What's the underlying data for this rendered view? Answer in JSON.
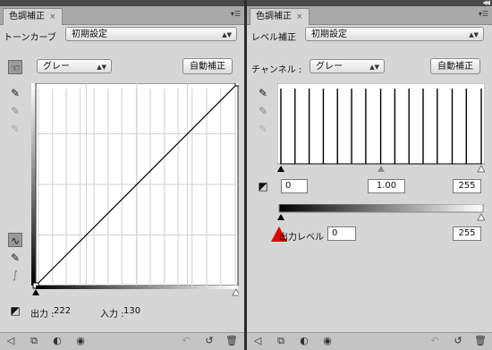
{
  "left": {
    "tab_title": "色調補正",
    "tab_close": "×",
    "preset_label": "トーンカーブ",
    "preset_value": "初期設定",
    "channel_value": "グレー",
    "auto_button": "自動補正",
    "output_label": "出力 :",
    "output_value": "222",
    "input_label": "入力 :",
    "input_value": "130",
    "curve_points": [
      [
        0,
        0
      ],
      [
        255,
        255
      ]
    ]
  },
  "right": {
    "tab_title": "色調補正",
    "tab_close": "×",
    "preset_label": "レベル補正",
    "preset_value": "初期設定",
    "channel_label": "チャンネル :",
    "channel_value": "グレー",
    "auto_button": "自動補正",
    "input_shadow": "0",
    "input_gamma": "1.00",
    "input_highlight": "255",
    "output_label": "出力レベル :",
    "output_shadow": "0",
    "output_highlight": "255",
    "histogram_bin_positions": [
      0,
      18,
      36,
      54,
      72,
      90,
      108,
      127,
      145,
      163,
      181,
      199,
      218,
      236,
      255
    ]
  },
  "icons": {
    "panel_menu": "☰",
    "collapse": "◀◀"
  },
  "colors": {
    "panel_bg": "#d6d6d6",
    "warning_red": "#e00000",
    "grid_line": "#cccccc"
  }
}
